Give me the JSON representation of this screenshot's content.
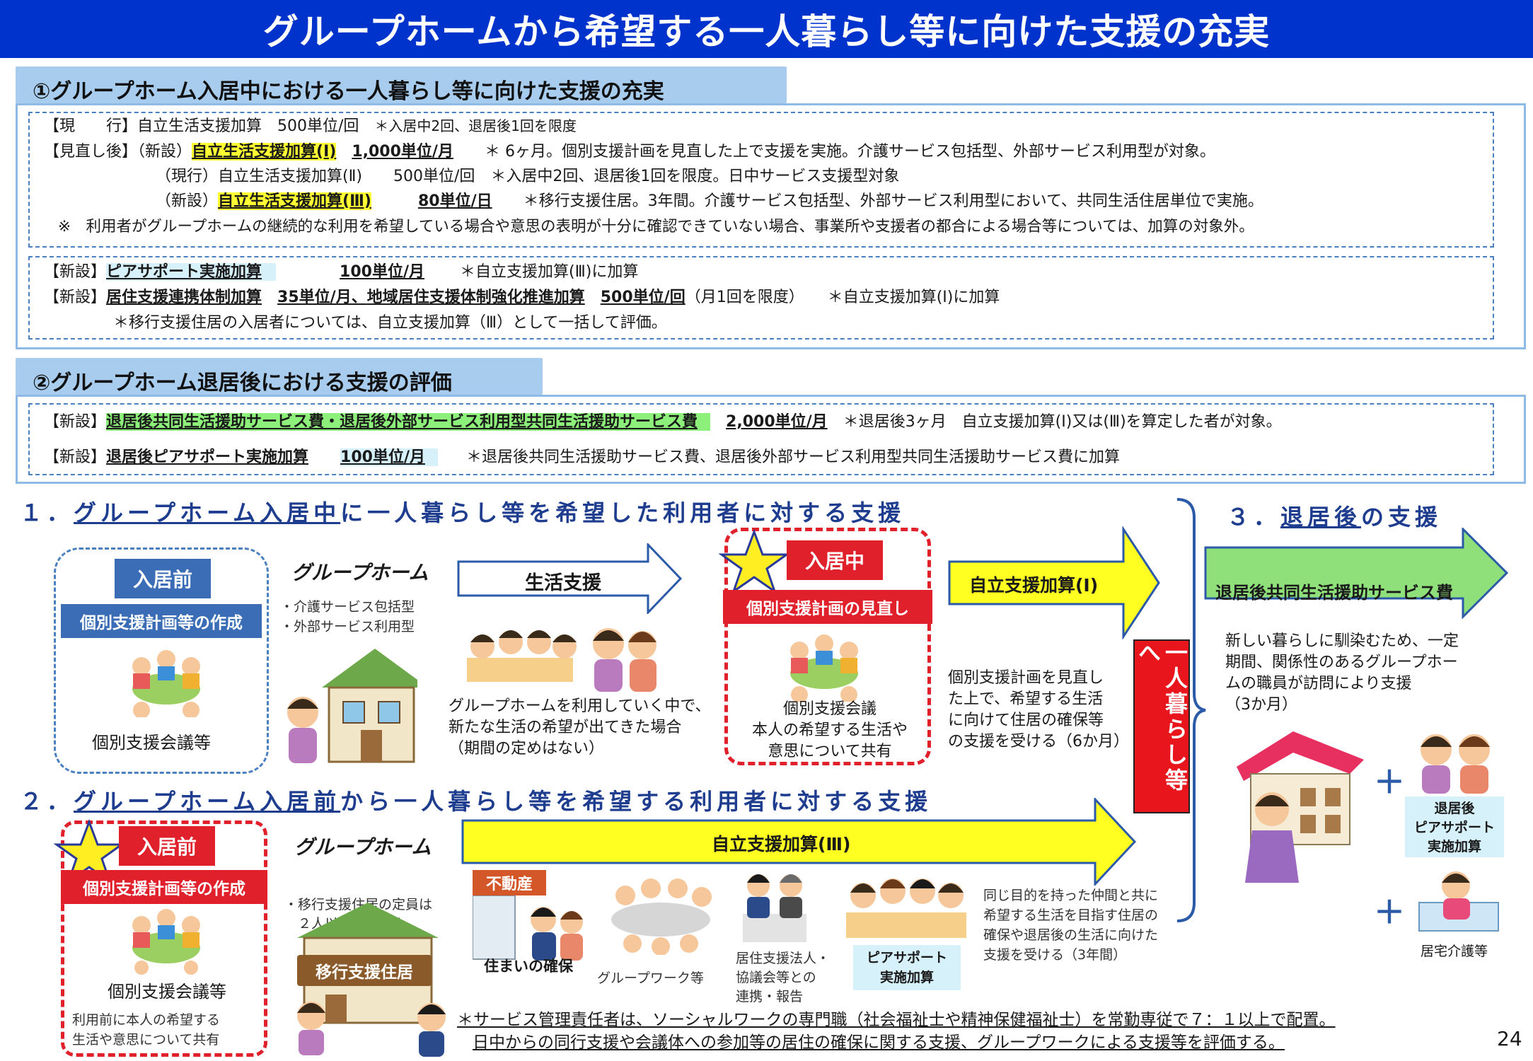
{
  "title": "グループホームから希望する一人暮らし等に向けた支援の充実",
  "section1": {
    "heading": "①グループホーム入居中における一人暮らし等に向けた支援の充実",
    "box1": {
      "l1a": "【現　　行】自立生活支援加算　500単位/回",
      "l1b": "＊入居中2回、退居後1回を限度",
      "l2a": "【見直し後】（新設）",
      "l2b": "自立生活支援加算(Ⅰ)",
      "l2c": "1,000単位/月",
      "l2d": "＊ 6ヶ月。個別支援計画を見直した上で支援を実施。介護サービス包括型、外部サービス利用型が対象。",
      "l3a": "（現行）自立生活支援加算(Ⅱ)　　500単位/回",
      "l3b": "＊入居中2回、退居後1回を限度。日中サービス支援型対象",
      "l4a": "（新設）",
      "l4b": "自立生活支援加算(Ⅲ)",
      "l4c": "80単位/日",
      "l4d": "＊移行支援住居。3年間。介護サービス包括型、外部サービス利用型において、共同生活住居単位で実施。",
      "l5": "※　利用者がグループホームの継続的な利用を希望している場合や意思の表明が十分に確認できていない場合、事業所や支援者の都合による場合等については、加算の対象外。"
    },
    "box2": {
      "l1a": "【新設】",
      "l1b": "ピアサポート実施加算",
      "l1c": "100単位/月",
      "l1d": "＊自立支援加算(Ⅲ)に加算",
      "l2a": "【新設】",
      "l2b": "居住支援連携体制加算",
      "l2c": "35単位/月、",
      "l2d": "地域居住支援体制強化推進加算",
      "l2e": "500単位/回",
      "l2f": "（月1回を限度）",
      "l2g": "＊自立支援加算(Ⅰ)に加算",
      "l3": "＊移行支援住居の入居者については、自立支援加算（Ⅲ）として一括して評価。"
    }
  },
  "section2": {
    "heading": "②グループホーム退居後における支援の評価",
    "l1a": "【新設】",
    "l1b": "退居後共同生活援助サービス費・退居後外部サービス利用型共同生活援助サービス費",
    "l1c": "2,000単位/月",
    "l1d": "＊退居後3ヶ月　自立支援加算(Ⅰ)又は(Ⅲ)を算定した者が対象。",
    "l2a": "【新設】",
    "l2b": "退居後ピアサポート実施加算",
    "l2c": "100単位/月",
    "l2d": "＊退居後共同生活援助サービス費、退居後外部サービス利用型共同生活援助サービス費に加算"
  },
  "flow1": {
    "heading_pre": "１．",
    "heading_u": "グループホーム入居中",
    "heading_post": "に一人暮らし等を希望した利用者に対する支援",
    "before_label": "入居前",
    "plan_label": "個別支援計画等の作成",
    "meeting_label": "個別支援会議等",
    "gh_title": "グループホーム",
    "gh_types": [
      "・介護サービス包括型",
      "・外部サービス利用型"
    ],
    "life_support": "生活支援",
    "life_desc": [
      "グループホームを利用していく中で、",
      "新たな生活の希望が出てきた場合",
      "（期間の定めはない）"
    ],
    "during_label": "入居中",
    "review_label": "個別支援計画の見直し",
    "during_desc": [
      "個別支援会議",
      "本人の希望する生活や",
      "意思について共有"
    ],
    "addon1": "自立支援加算(Ⅰ)",
    "addon1_desc": [
      "個別支援計画を見直し",
      "た上で、希望する生活",
      "に向けて住居の確保等",
      "の支援を受ける（6か月）"
    ]
  },
  "vertical_label": "一人暮らし等へ",
  "flow3": {
    "heading_pre": "３．",
    "heading_u": "退居後",
    "heading_post": "の支援",
    "service": "退居後共同生活援助サービス費",
    "desc": [
      "新しい暮らしに馴染むため、一定",
      "期間、関係性のあるグループホー",
      "ムの職員が訪問により支援",
      "（3か月）"
    ],
    "plus1": "＋",
    "peer": [
      "退居後",
      "ピアサポート",
      "実施加算"
    ],
    "plus2": "＋",
    "home_care": "居宅介護等"
  },
  "flow2": {
    "heading_pre": "２．",
    "heading_u": "グループホーム入居前",
    "heading_post": "から一人暮らし等を希望する利用者に対する支援",
    "before_label": "入居前",
    "plan_label": "個別支援計画等の作成",
    "meeting_label": "個別支援会議等",
    "share": [
      "利用前に本人の希望する",
      "生活や意思について共有"
    ],
    "gh_title": "グループホーム",
    "gh_desc": [
      "・移行支援住居の定員は",
      "　２人以上7人以下。"
    ],
    "house_label": "移行支援住居",
    "addon3": "自立支援加算(Ⅲ)",
    "realestate": "不動産",
    "housing": "住まいの確保",
    "groupwork": "グループワーク等",
    "liaison": [
      "居住支援法人・",
      "協議会等との",
      "連携・報告"
    ],
    "peer": [
      "ピアサポート",
      "実施加算"
    ],
    "desc": [
      "同じ目的を持った仲間と共に",
      "希望する生活を目指す住居の",
      "確保や退居後の生活に向けた",
      "支援を受ける（3年間）"
    ],
    "footnote1": "＊サービス管理責任者は、ソーシャルワークの専門職（社会福祉士や精神保健福祉士）を常勤専従で７：１以上で配置。",
    "footnote2": "日中からの同行支援や会議体への参加等の居住の確保に関する支援、グループワークによる支援等を評価する。"
  },
  "page_number": "24"
}
